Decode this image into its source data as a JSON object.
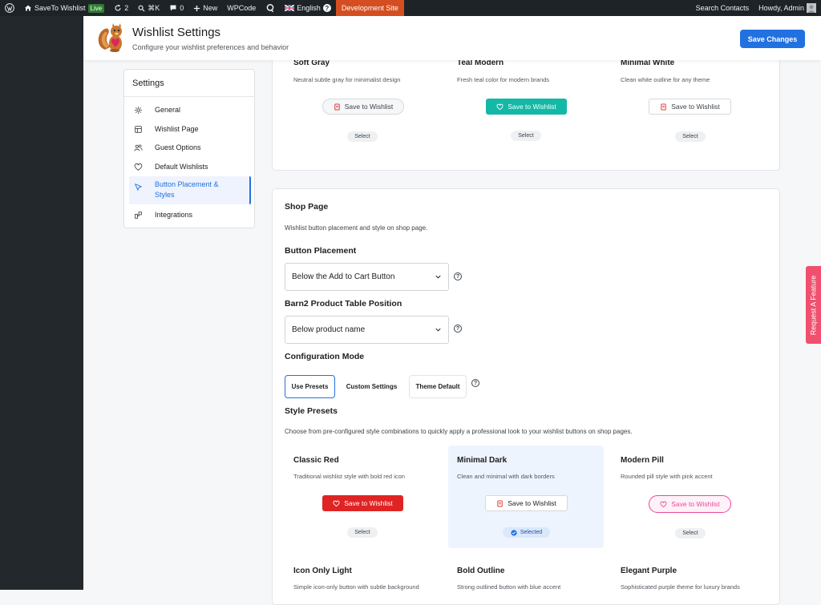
{
  "admin_bar": {
    "site_name": "SaveTo Wishlist",
    "live_badge": "Live",
    "updates_count": "2",
    "command_shortcut": "⌘K",
    "comments_count": "0",
    "new_label": "New",
    "wpcode_label": "WPCode",
    "language": "English",
    "dev_site": "Development Site",
    "search_contacts": "Search Contacts",
    "howdy": "Howdy, Admin"
  },
  "header": {
    "title": "Wishlist Settings",
    "subtitle": "Configure your wishlist preferences and behavior",
    "save_label": "Save Changes"
  },
  "sidebar": {
    "title": "Settings",
    "items": [
      {
        "label": "General",
        "icon": "gear-icon"
      },
      {
        "label": "Wishlist Page",
        "icon": "layout-icon"
      },
      {
        "label": "Guest Options",
        "icon": "users-icon"
      },
      {
        "label": "Default Wishlists",
        "icon": "heart-icon"
      },
      {
        "label": "Button Placement & Styles",
        "icon": "cursor-icon",
        "active": true
      },
      {
        "label": "Integrations",
        "icon": "integrations-icon"
      }
    ]
  },
  "top_presets": [
    {
      "name": "Soft Gray",
      "desc": "Neutral subtle gray for minimalist design",
      "button": "Save to Wishlist",
      "select": "Select"
    },
    {
      "name": "Teal Modern",
      "desc": "Fresh teal color for modern brands",
      "button": "Save to Wishlist",
      "select": "Select"
    },
    {
      "name": "Minimal White",
      "desc": "Clean white outline for any theme",
      "button": "Save to Wishlist",
      "select": "Select"
    }
  ],
  "shop_page": {
    "title": "Shop Page",
    "desc": "Wishlist button placement and style on shop page.",
    "placement_label": "Button Placement",
    "placement_value": "Below the Add to Cart Button",
    "barn2_label": "Barn2 Product Table Position",
    "barn2_value": "Below product name",
    "config_label": "Configuration Mode",
    "modes": [
      "Use Presets",
      "Custom Settings",
      "Theme Default"
    ],
    "active_mode": "Use Presets",
    "style_presets_title": "Style Presets",
    "style_presets_desc": "Choose from pre-configured style combinations to quickly apply a professional look to your wishlist buttons on shop pages.",
    "presets": [
      {
        "name": "Classic Red",
        "desc": "Traditional wishlist style with bold red icon",
        "button": "Save to Wishlist",
        "select": "Select"
      },
      {
        "name": "Minimal Dark",
        "desc": "Clean and minimal with dark borders",
        "button": "Save to Wishlist",
        "select": "Selected"
      },
      {
        "name": "Modern Pill",
        "desc": "Rounded pill style with pink accent",
        "button": "Save to Wishlist",
        "select": "Select"
      },
      {
        "name": "Icon Only Light",
        "desc": "Simple icon-only button with subtle background"
      },
      {
        "name": "Bold Outline",
        "desc": "Strong outlined button with blue accent"
      },
      {
        "name": "Elegant Purple",
        "desc": "Sophisticated purple theme for luxury brands"
      }
    ]
  },
  "feature_tab": "Request A Feature",
  "colors": {
    "accent": "#2271e1",
    "red": "#e02424",
    "teal": "#14b8a6",
    "pink": "#ec4899"
  }
}
